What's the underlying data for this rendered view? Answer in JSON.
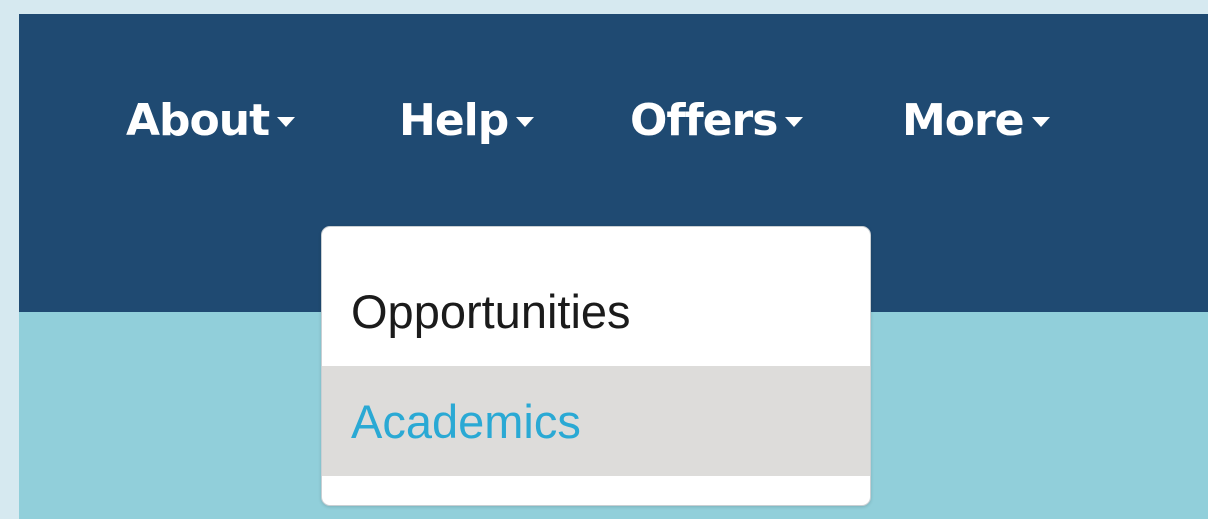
{
  "nav": {
    "items": [
      {
        "label": "About",
        "icon": "caret-down-icon"
      },
      {
        "label": "Help",
        "icon": "caret-down-icon"
      },
      {
        "label": "Offers",
        "icon": "caret-down-icon"
      },
      {
        "label": "More",
        "icon": "caret-down-icon"
      }
    ]
  },
  "dropdown": {
    "items": [
      {
        "label": "Opportunities"
      },
      {
        "label": "Academics",
        "state": "hover"
      }
    ]
  },
  "colors": {
    "page_background": "#d6e9f0",
    "navbar": "#1f4a72",
    "content_background": "#91cfda",
    "dropdown_background": "#ffffff",
    "hover_background": "#dddcda",
    "hover_text": "#2aa9d4",
    "nav_text": "#ffffff"
  }
}
